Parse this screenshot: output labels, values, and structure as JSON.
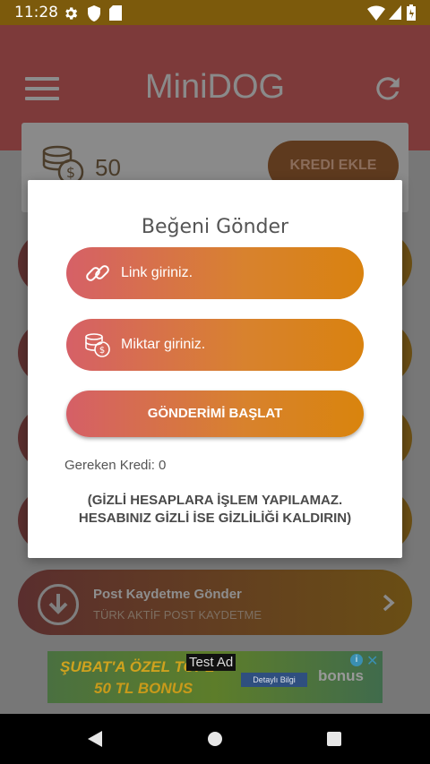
{
  "status_bar": {
    "time": "11:28"
  },
  "app_bar": {
    "title": "MiniDOG"
  },
  "credit_card": {
    "amount": "50",
    "add_button": "KREDI EKLE"
  },
  "menu_item_bottom": {
    "title": "Post Kaydetme Gönder",
    "subtitle": "TÜRK AKTİF POST KAYDETME"
  },
  "ad": {
    "label": "Test Ad",
    "line1": "ŞUBAT'A ÖZEL TOPL",
    "line2": "50 TL BONUS",
    "detay": "Detaylı Bilgi",
    "brand": "bonus"
  },
  "dialog": {
    "title": "Beğeni Gönder",
    "link_placeholder": "Link giriniz.",
    "amount_placeholder": "Miktar giriniz.",
    "start_button": "GÖNDERİMİ BAŞLAT",
    "required_credit": "Gereken Kredi: 0",
    "warning_line1": "(GİZLİ HESAPLARA İŞLEM YAPILAMAZ.",
    "warning_line2": "HESABINIZ GİZLİ İSE GİZLİLİĞİ KALDIRIN)"
  },
  "colors": {
    "gradient_start": "#d66067",
    "gradient_end": "#d9820f"
  }
}
